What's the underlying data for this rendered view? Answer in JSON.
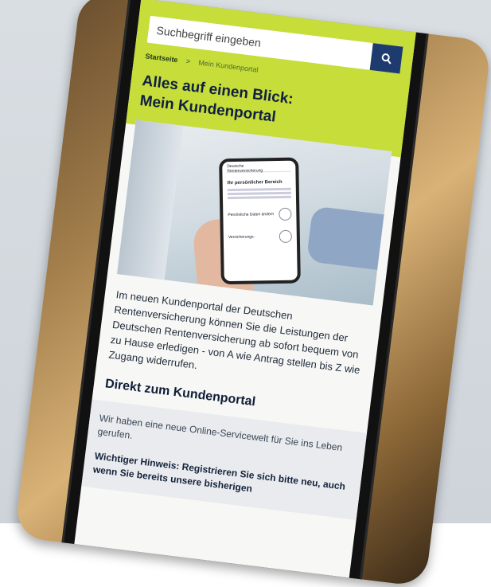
{
  "search": {
    "placeholder": "Suchbegriff eingeben"
  },
  "breadcrumb": {
    "home": "Startseite",
    "separator": ">",
    "current": "Mein Kundenportal"
  },
  "page": {
    "title_line1": "Alles auf einen Blick:",
    "title_line2": "Mein Kundenportal"
  },
  "mini_phone": {
    "brand_line1": "Deutsche",
    "brand_line2": "Rentenversicherung",
    "heading": "Ihr persönlicher Bereich",
    "row1": "Persönliche Daten ändern",
    "row2": "Versicherungs-"
  },
  "intro": "Im neuen Kundenportal der Deutschen Rentenversicherung können Sie die Leistungen der Deutschen Rentenversicherung ab sofort bequem von zu Hause erledigen - von A wie Antrag stellen bis Z wie Zugang widerrufen.",
  "section": {
    "heading": "Direkt zum Kundenportal"
  },
  "notice": {
    "text": "Wir haben eine neue Online-Servicewelt für Sie ins Leben gerufen.",
    "strong": "Wichtiger Hinweis: Registrieren Sie sich bitte neu, auch wenn Sie bereits unsere bisherigen"
  },
  "colors": {
    "accent_green": "#c6dd3a",
    "navy": "#1d3b6e"
  },
  "icons": {
    "search": "magnifier-icon"
  }
}
